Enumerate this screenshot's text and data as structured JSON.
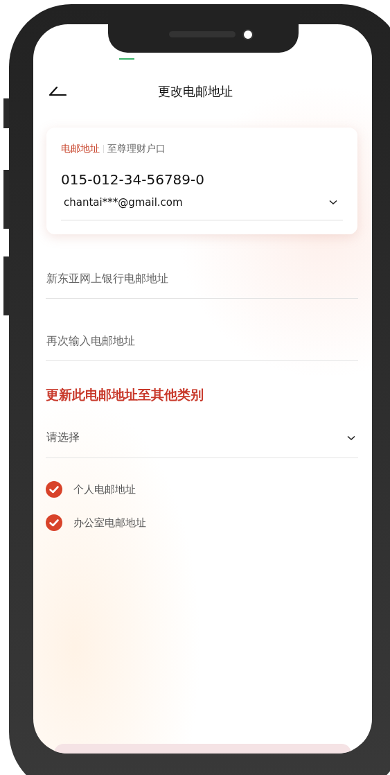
{
  "header": {
    "title": "更改电邮地址"
  },
  "account_card": {
    "tabs": [
      {
        "label": "电邮地址",
        "selected": true
      },
      {
        "label": "至尊理财户口",
        "selected": false
      }
    ],
    "account_number": "015-012-34-56789-0",
    "email": "chantai***@gmail.com"
  },
  "fields": [
    {
      "placeholder": "新东亚网上银行电邮地址"
    },
    {
      "placeholder": "再次输入电邮地址"
    }
  ],
  "section_title": "更新此电邮地址至其他类别",
  "category_select": {
    "placeholder": "请选择"
  },
  "categories": [
    {
      "label": "个人电邮地址",
      "checked": true
    },
    {
      "label": "办公室电邮地址",
      "checked": true
    }
  ]
}
